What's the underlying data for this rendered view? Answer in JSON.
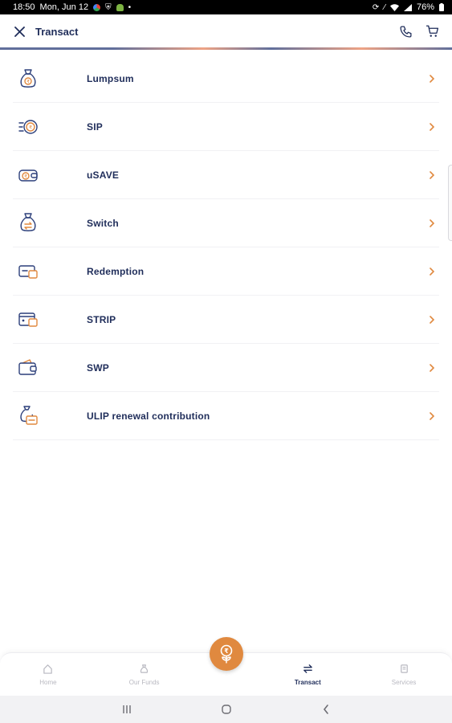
{
  "status_bar": {
    "time": "18:50",
    "date": "Mon, Jun 12",
    "battery": "76%"
  },
  "header": {
    "title": "Transact",
    "close_icon": "close-icon",
    "phone_icon": "phone-icon",
    "cart_icon": "cart-icon"
  },
  "transactions": [
    {
      "label": "Lumpsum",
      "icon": "money-bag-icon"
    },
    {
      "label": "SIP",
      "icon": "sip-coins-icon"
    },
    {
      "label": "uSAVE",
      "icon": "wallet-coin-icon"
    },
    {
      "label": "Switch",
      "icon": "switch-bag-icon"
    },
    {
      "label": "Redemption",
      "icon": "redemption-wallet-icon"
    },
    {
      "label": "STRIP",
      "icon": "strip-wallet-icon"
    },
    {
      "label": "SWP",
      "icon": "swp-wallet-icon"
    },
    {
      "label": "ULIP renewal contribution",
      "icon": "ulip-bag-icon"
    }
  ],
  "bottom_nav": {
    "items": [
      {
        "label": "Home",
        "icon": "home-icon",
        "active": false
      },
      {
        "label": "Our Funds",
        "icon": "funds-icon",
        "active": false
      },
      {
        "label": "Transact",
        "icon": "transact-icon",
        "active": true
      },
      {
        "label": "Services",
        "icon": "services-icon",
        "active": false
      }
    ],
    "fab_icon": "rupee-plant-icon"
  },
  "colors": {
    "primary": "#1f2d5a",
    "accent": "#e0893f",
    "muted": "#b8b8c0"
  }
}
